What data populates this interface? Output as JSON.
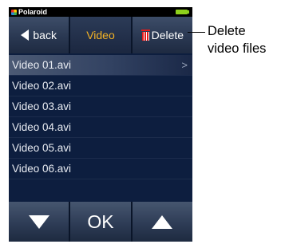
{
  "status_bar": {
    "brand": "Polaroid"
  },
  "top_bar": {
    "back_label": "back",
    "title": "Video",
    "delete_label": "Delete"
  },
  "file_list": {
    "items": [
      {
        "label": "Video 01.avi",
        "selected": true
      },
      {
        "label": "Video 02.avi"
      },
      {
        "label": "Video 03.avi"
      },
      {
        "label": "Video 04.avi"
      },
      {
        "label": "Video 05.avi"
      },
      {
        "label": "Video 06.avi"
      }
    ]
  },
  "bottom_bar": {
    "ok_label": "OK"
  },
  "annotation": {
    "line1": "Delete",
    "line2": "video files"
  },
  "colors": {
    "active_tab": "#f3b225",
    "delete_icon": "#e11b1b",
    "battery": "#8ed11b",
    "background": "#0d1e3f"
  },
  "icons": [
    "polaroid-logo-icon",
    "battery-icon",
    "back-arrow-icon",
    "trash-icon",
    "chevron-right-icon",
    "arrow-down-icon",
    "arrow-up-icon"
  ]
}
